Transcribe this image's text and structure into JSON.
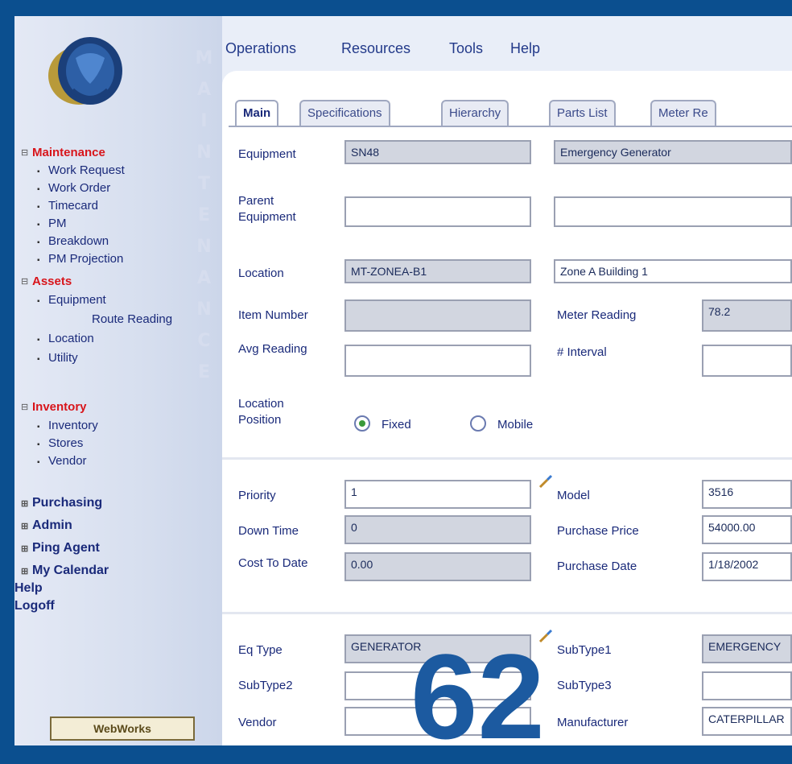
{
  "sidebar": {
    "vertical_text": "MAINTENANCE",
    "sections": [
      {
        "label": "Maintenance",
        "items": [
          "Work Request",
          "Work Order",
          "Timecard",
          "PM",
          "Breakdown",
          "PM Projection"
        ]
      },
      {
        "label": "Assets",
        "items": [
          "Equipment",
          "Route Reading",
          "Location",
          "Utility"
        ]
      },
      {
        "label": "Inventory",
        "items": [
          "Inventory",
          "Stores",
          "Vendor"
        ]
      }
    ],
    "other_sections": [
      "Purchasing",
      "Admin",
      "Ping Agent",
      "My Calendar"
    ],
    "links": [
      "Help",
      "Logoff"
    ],
    "badge": "WebWorks"
  },
  "menubar": {
    "items": [
      "Operations",
      "Resources",
      "Tools",
      "Help"
    ]
  },
  "tabs": [
    "Main",
    "Specifications",
    "Hierarchy",
    "Parts List",
    "Meter Re"
  ],
  "form": {
    "equipment_label": "Equipment",
    "equipment_value": "SN48",
    "equipment_desc": "Emergency Generator",
    "parent_label": "Parent Equipment",
    "parent_value": "",
    "parent_desc": "",
    "location_label": "Location",
    "location_value": "MT-ZONEA-B1",
    "location_desc": "Zone A Building 1",
    "item_label": "Item Number",
    "item_value": "",
    "meter_label": "Meter Reading",
    "meter_value": "78.2",
    "avg_label": "Avg Reading",
    "avg_value": "",
    "interval_label": "# Interval",
    "interval_value": "",
    "loc_pos_label": "Location Position",
    "radio_fixed": "Fixed",
    "radio_mobile": "Mobile",
    "priority_label": "Priority",
    "priority_value": "1",
    "model_label": "Model",
    "model_value": "3516",
    "down_label": "Down Time",
    "down_value": "0",
    "purchase_price_label": "Purchase Price",
    "purchase_price_value": "54000.00",
    "cost_label": "Cost To Date",
    "cost_value": "0.00",
    "purchase_date_label": "Purchase Date",
    "purchase_date_value": "1/18/2002",
    "eq_type_label": "Eq Type",
    "eq_type_value": "GENERATOR",
    "subtype1_label": "SubType1",
    "subtype1_value": "EMERGENCY",
    "subtype2_label": "SubType2",
    "subtype2_value": "",
    "subtype3_label": "SubType3",
    "subtype3_value": "",
    "vendor_label": "Vendor",
    "vendor_value": "",
    "manufacturer_label": "Manufacturer",
    "manufacturer_value": "CATERPILLAR"
  },
  "overlay_number": "62",
  "colors": {
    "frame": "#0b4f8f",
    "accent_red": "#d8151b",
    "link_blue": "#1a2a7a"
  }
}
